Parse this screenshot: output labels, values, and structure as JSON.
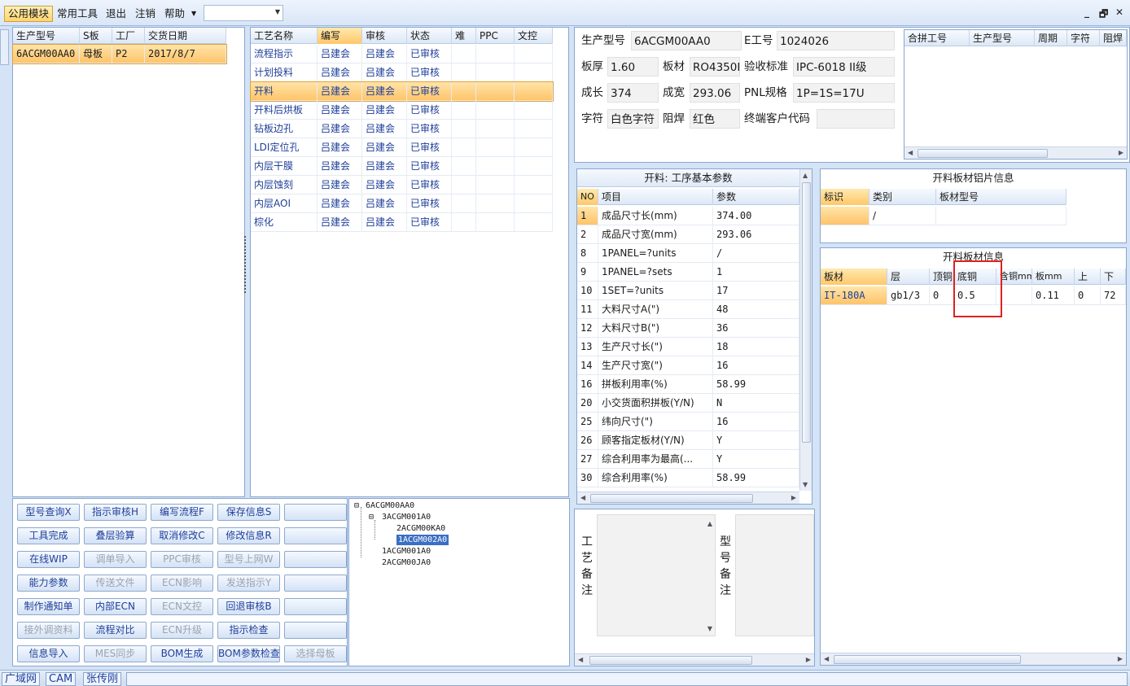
{
  "menubar": {
    "items": [
      "公用模块",
      "常用工具",
      "退出",
      "注销",
      "帮助"
    ],
    "combo_value": ""
  },
  "orders": {
    "headers": [
      "生产型号",
      "S板",
      "工厂",
      "交货日期"
    ],
    "rows": [
      [
        "6ACGM00AA0",
        "母板",
        "P2",
        "2017/8/7"
      ]
    ]
  },
  "processes": {
    "headers": [
      "工艺名称",
      "编写",
      "审核",
      "状态",
      "难",
      "PPC",
      "文控"
    ],
    "rows": [
      [
        "流程指示",
        "吕建会",
        "吕建会",
        "已审核"
      ],
      [
        "计划投料",
        "吕建会",
        "吕建会",
        "已审核"
      ],
      [
        "开料",
        "吕建会",
        "吕建会",
        "已审核"
      ],
      [
        "开料后烘板",
        "吕建会",
        "吕建会",
        "已审核"
      ],
      [
        "钻板边孔",
        "吕建会",
        "吕建会",
        "已审核"
      ],
      [
        "LDI定位孔",
        "吕建会",
        "吕建会",
        "已审核"
      ],
      [
        "内层干膜",
        "吕建会",
        "吕建会",
        "已审核"
      ],
      [
        "内层蚀刻",
        "吕建会",
        "吕建会",
        "已审核"
      ],
      [
        "内层AOI",
        "吕建会",
        "吕建会",
        "已审核"
      ],
      [
        "棕化",
        "吕建会",
        "吕建会",
        "已审核"
      ]
    ],
    "selected_index": 2
  },
  "info": {
    "labels": {
      "model": "生产型号",
      "e_no": "E工号",
      "thickness": "板厚",
      "material": "板材",
      "standard": "验收标准",
      "length": "成长",
      "width": "成宽",
      "pnl": "PNL规格",
      "char": "字符",
      "mask": "阻焊",
      "customer": "终端客户代码"
    },
    "values": {
      "model": "6ACGM00AA0",
      "e_no": "1024026",
      "thickness": "1.60",
      "material": "RO4350B",
      "standard": "IPC-6018 II级",
      "length": "374",
      "width": "293.06",
      "pnl": "1P=1S=17U",
      "char": "白色字符",
      "mask": "红色",
      "customer": ""
    }
  },
  "combine": {
    "headers": [
      "合拼工号",
      "生产型号",
      "周期",
      "字符",
      "阻焊"
    ]
  },
  "params": {
    "title": "开料: 工序基本参数",
    "headers": [
      "NO",
      "项目",
      "参数"
    ],
    "rows": [
      [
        "1",
        "成品尺寸长(mm)",
        "374.00"
      ],
      [
        "2",
        "成品尺寸宽(mm)",
        "293.06"
      ],
      [
        "8",
        "1PANEL=?units",
        "/"
      ],
      [
        "9",
        "1PANEL=?sets",
        "1"
      ],
      [
        "10",
        "1SET=?units",
        "17"
      ],
      [
        "11",
        "大料尺寸A(\")",
        "48"
      ],
      [
        "12",
        "大料尺寸B(\")",
        "36"
      ],
      [
        "13",
        "生产尺寸长(\")",
        "18"
      ],
      [
        "14",
        "生产尺寸宽(\")",
        "16"
      ],
      [
        "16",
        "拼板利用率(%)",
        "58.99"
      ],
      [
        "20",
        "小交货面积拼板(Y/N)",
        "N"
      ],
      [
        "25",
        "纬向尺寸(\")",
        "16"
      ],
      [
        "26",
        "顾客指定板材(Y/N)",
        "Y"
      ],
      [
        "27",
        "综合利用率为最高(...",
        "Y"
      ],
      [
        "30",
        "综合利用率(%)",
        "58.99"
      ]
    ]
  },
  "alu": {
    "title": "开料板材铝片信息",
    "headers": [
      "标识",
      "类别",
      "板材型号"
    ],
    "rows": [
      [
        "",
        "/",
        ""
      ]
    ]
  },
  "material": {
    "title": "开料板材信息",
    "headers": [
      "板材",
      "层",
      "顶铜",
      "底铜",
      "含铜mm",
      "板mm",
      "上",
      "下"
    ],
    "rows": [
      [
        "IT-180A",
        "gb1/3",
        "0",
        "0.5",
        "",
        "0.11",
        "0",
        "72"
      ]
    ]
  },
  "buttons": [
    [
      "型号查询X",
      "指示审核H",
      "编写流程F",
      "保存信息S",
      ""
    ],
    [
      "工具完成",
      "叠层验算",
      "取消修改C",
      "修改信息R",
      ""
    ],
    [
      "在线WIP",
      "调单导入",
      "PPC审核",
      "型号上网W",
      ""
    ],
    [
      "能力参数",
      "传送文件",
      "ECN影响",
      "发送指示Y",
      ""
    ],
    [
      "制作通知单",
      "内部ECN",
      "ECN文控",
      "回退审核B",
      ""
    ],
    [
      "接外调资料",
      "流程对比",
      "ECN升级",
      "指示检查",
      ""
    ],
    [
      "信息导入",
      "MES同步",
      "BOM生成",
      "BOM参数检查",
      "选择母板"
    ]
  ],
  "disabled_buttons": [
    "调单导入",
    "PPC审核",
    "型号上网W",
    "传送文件",
    "ECN影响",
    "发送指示Y",
    "ECN文控",
    "接外调资料",
    "ECN升级",
    "MES同步",
    "选择母板"
  ],
  "tree": {
    "root": "6ACGM00AA0",
    "child": "3ACGM001A0",
    "grandchildren": [
      "2ACGM00KA0",
      "1ACGM002A0"
    ],
    "siblings": [
      "1ACGM001A0",
      "2ACGM00JA0"
    ]
  },
  "notes": {
    "process_label": "工艺备注",
    "model_label": "型号备注"
  },
  "statusbar": [
    "广域网",
    "CAM",
    "张传刚"
  ],
  "colors": {
    "accent": "#ffc86a",
    "highlight_box": "#e02020",
    "link": "#1f3f9a"
  }
}
